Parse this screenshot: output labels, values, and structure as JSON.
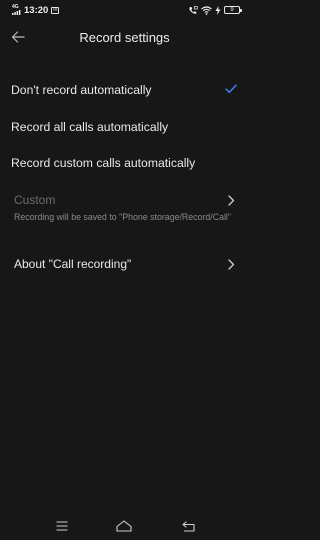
{
  "status_bar": {
    "network": "4G",
    "time": "13:20",
    "battery": "9"
  },
  "header": {
    "title": "Record settings"
  },
  "options": [
    {
      "label": "Don't record automatically",
      "selected": true
    },
    {
      "label": "Record all calls automatically",
      "selected": false
    },
    {
      "label": "Record custom calls automatically",
      "selected": false
    }
  ],
  "custom": {
    "label": "Custom",
    "note": "Recording will be saved to \"Phone storage/Record/Call\""
  },
  "about": {
    "label": "About \"Call recording\""
  },
  "colors": {
    "accent": "#3b7bea",
    "background": "#171717",
    "disabled_text": "#6d6d6d"
  }
}
